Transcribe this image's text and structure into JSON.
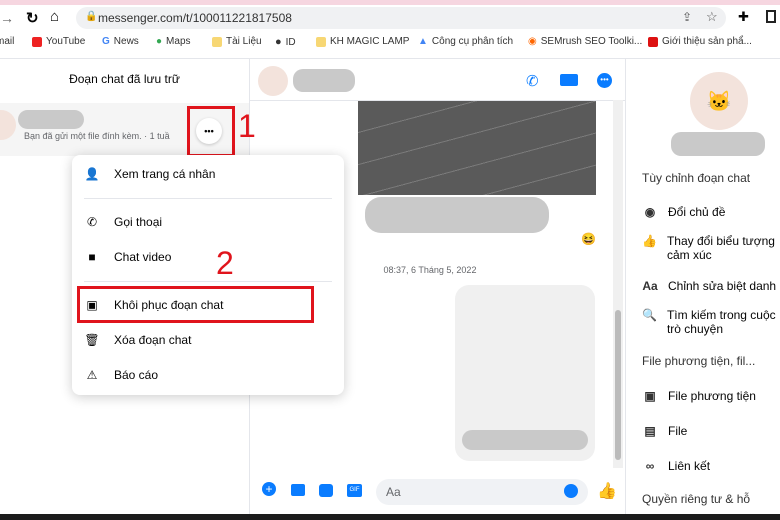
{
  "browser": {
    "url": "messenger.com/t/100011221817508",
    "bookmarks": [
      "mail",
      "YouTube",
      "News",
      "Maps",
      "Tài Liệu",
      "ID",
      "KH MAGIC LAMP",
      "Công cụ phân tích",
      "SEMrush SEO Toolki...",
      "Giới thiệu sản phẩ..."
    ]
  },
  "left": {
    "title": "Đoạn chat đã lưu trữ",
    "chat_preview": "Bạn đã gửi một file đính kèm. · 1 tuầ",
    "more_button": "•••"
  },
  "menu": {
    "items": [
      "Xem trang cá nhân",
      "Gọi thoại",
      "Chat video",
      "Khôi phục đoạn chat",
      "Xóa đoạn chat",
      "Báo cáo"
    ]
  },
  "annotations": {
    "step1": "1",
    "step2": "2"
  },
  "conversation": {
    "timestamp": "08:37, 6 Tháng 5, 2022",
    "composer_placeholder": "Aa",
    "emoji": "😆"
  },
  "right": {
    "section1": "Tùy chỉnh đoạn chat",
    "items1": [
      "Đổi chủ đề",
      "Thay đổi biểu tượng cảm xúc",
      "Chỉnh sửa biệt danh",
      "Tìm kiếm trong cuộc trò chuyện"
    ],
    "section2": "File phương tiện, fil...",
    "items2": [
      "File phương tiện",
      "File",
      "Liên kết"
    ],
    "section3": "Quyền riêng tư & hỗ"
  },
  "colors": {
    "accent": "#0a7cff",
    "highlight": "#e0141c"
  }
}
